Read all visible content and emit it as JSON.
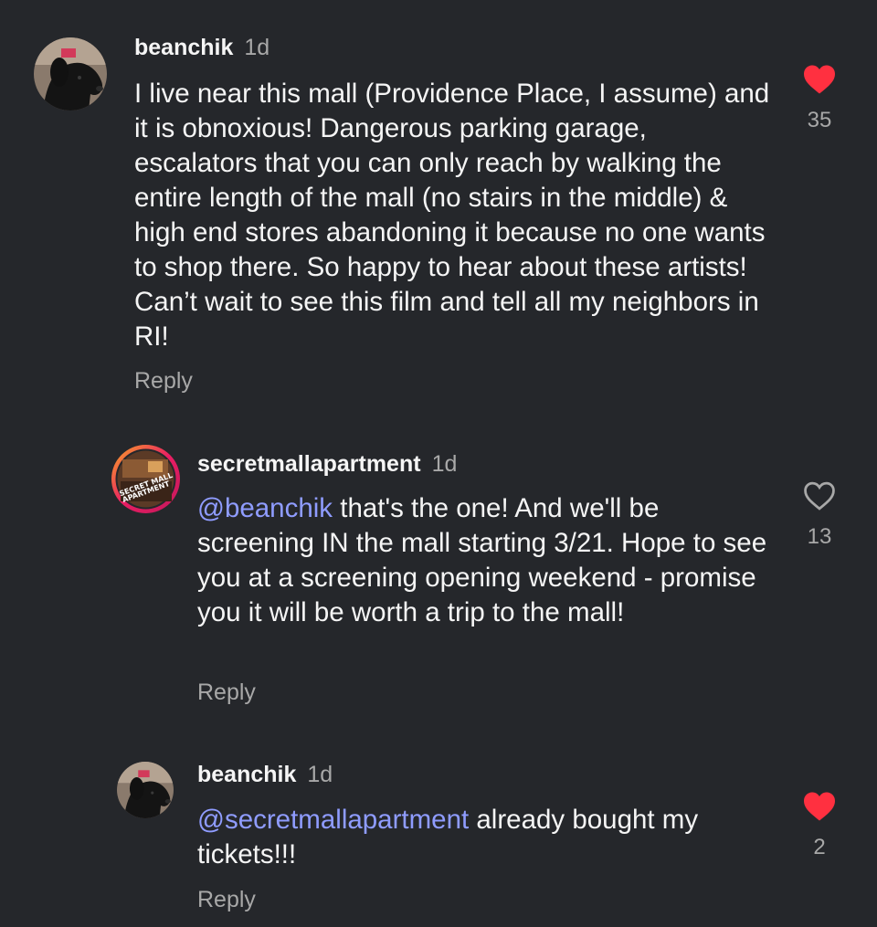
{
  "colors": {
    "background": "#25272b",
    "mention": "#8f9cff",
    "liked_heart": "#ff3040",
    "secondary_text": "#a8a8a8"
  },
  "comments": [
    {
      "username": "beanchik",
      "time": "1d",
      "avatar_icon": "dog-avatar",
      "text": "I live near this mall (Providence Place, I assume) and it is obnoxious! Dangerous parking garage, escalators that you can only reach by walking the entire length of the mall (no stairs in the middle) & high end stores abandoning it because no one wants to shop there. So happy to hear about these artists! Can’t wait to see this film and tell all my neighbors in RI!",
      "reply_label": "Reply",
      "likes": "35",
      "liked": true
    },
    {
      "username": "secretmallapartment",
      "time": "1d",
      "avatar_icon": "secret-mall-apartment-logo",
      "avatar_text": "SECRET MALL APARTMENT",
      "mention": "@beanchik",
      "text": " that's the one! And we'll be screening IN the mall starting 3/21. Hope to see you at a screening opening weekend - promise you it will be worth a trip to the mall!",
      "reply_label": "Reply",
      "likes": "13",
      "liked": false
    },
    {
      "username": "beanchik",
      "time": "1d",
      "avatar_icon": "dog-avatar",
      "mention": "@secretmallapartment",
      "text": " already bought my tickets!!!",
      "reply_label": "Reply",
      "likes": "2",
      "liked": true
    }
  ]
}
